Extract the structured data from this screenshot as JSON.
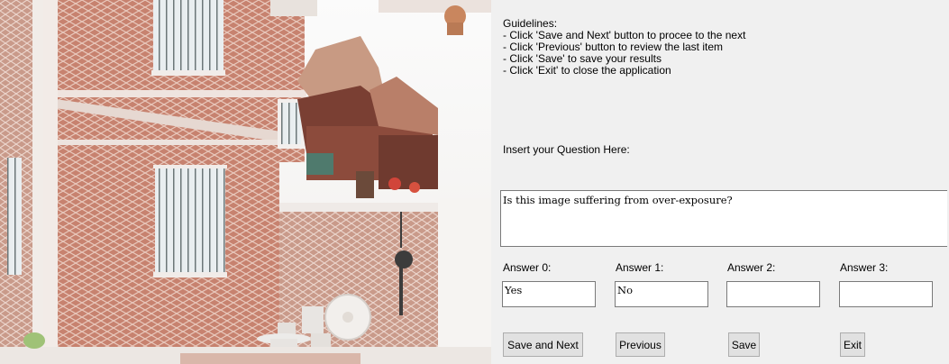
{
  "guidelines": {
    "lines": [
      "Guidelines:",
      "- Click 'Save and Next' button to procee to the next",
      "- Click 'Previous' button to review the last item",
      "- Click 'Save' to save your results",
      "- Click 'Exit' to close the application"
    ]
  },
  "question": {
    "label": "Insert your Question Here:",
    "text": "Is this image suffering from over-exposure?"
  },
  "answers": [
    {
      "label": "Answer 0:",
      "value": "Yes"
    },
    {
      "label": "Answer 1:",
      "value": "No"
    },
    {
      "label": "Answer 2:",
      "value": ""
    },
    {
      "label": "Answer 3:",
      "value": ""
    }
  ],
  "buttons": {
    "save_next": "Save and Next",
    "previous": "Previous",
    "save": "Save",
    "exit": "Exit"
  },
  "colors": {
    "window_bg": "#f0f0f0",
    "brick": "#c98b78",
    "button_bg": "#e1e1e1"
  }
}
